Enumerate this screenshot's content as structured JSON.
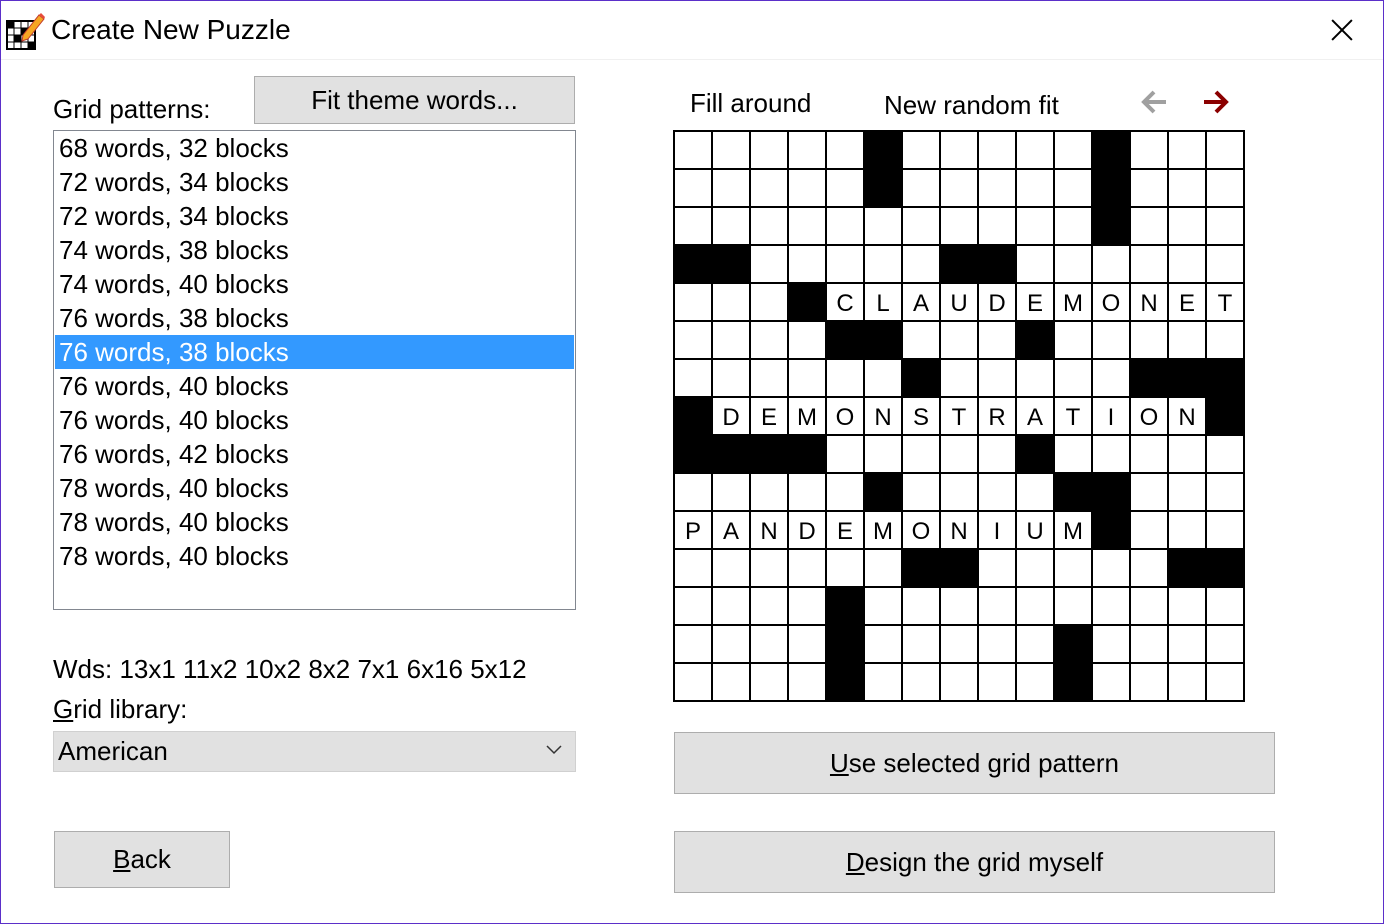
{
  "window": {
    "title": "Create New Puzzle",
    "app_icon": "crossword-pencil-icon",
    "close_icon": "close-icon"
  },
  "left": {
    "grid_patterns_label": "Grid patterns:",
    "fit_theme_button": "Fit theme words...",
    "patterns": [
      "68 words, 32 blocks",
      "72 words, 34 blocks",
      "72 words, 34 blocks",
      "74 words, 38 blocks",
      "74 words, 40 blocks",
      "76 words, 38 blocks",
      "76 words, 38 blocks",
      "76 words, 40 blocks",
      "76 words, 40 blocks",
      "76 words, 42 blocks",
      "78 words, 40 blocks",
      "78 words, 40 blocks",
      "78 words, 40 blocks"
    ],
    "selected_index": 6,
    "word_stats": "Wds: 13x1 11x2 10x2 8x2 7x1 6x16 5x12",
    "grid_library_label_mnemonic": "G",
    "grid_library_label_rest": "rid library:",
    "grid_library_value": "American",
    "back_button_mnemonic": "B",
    "back_button_rest": "ack"
  },
  "right": {
    "fill_around": "Fill around",
    "new_random_fit": "New random fit",
    "back_arrow_icon": "arrow-left-icon",
    "forward_arrow_icon": "arrow-right-icon",
    "back_arrow_color": "#a0a0a0",
    "forward_arrow_color": "#8b0000",
    "use_selected_mnemonic": "U",
    "use_selected_rest": "se selected grid pattern",
    "design_mnemonic": "D",
    "design_rest": "esign the grid myself"
  },
  "grid": {
    "rows": [
      ".....#.....#...",
      ".....#.....#...",
      "...........#...",
      "##.....##......",
      "...#CLAUDEMONET",
      "....##...#.....",
      "......#.....###",
      "#DEMONSTRATION#",
      "####.....#.....",
      ".....#....##...",
      "PANDEMONIUM#...",
      "......##.....##",
      "....#..........",
      "....#.....#....",
      "....#.....#...."
    ]
  }
}
